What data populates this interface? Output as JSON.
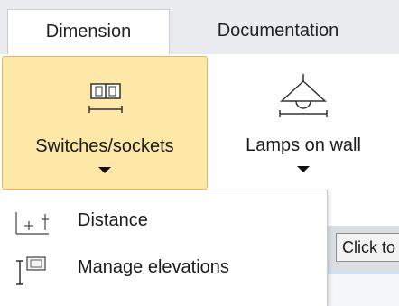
{
  "tabs": [
    {
      "label": "Dimension",
      "active": true
    },
    {
      "label": "Documentation",
      "active": false
    }
  ],
  "ribbon": {
    "switches_sockets": {
      "label": "Switches/sockets",
      "icon": "switch-socket-icon",
      "active": true
    },
    "lamps_on_wall": {
      "label": "Lamps on wall",
      "icon": "wall-lamp-icon"
    }
  },
  "dropdown": {
    "items": [
      {
        "label": "Distance",
        "icon": "distance-icon"
      },
      {
        "label": "Manage elevations",
        "icon": "elevation-icon"
      }
    ]
  },
  "statusbar": {
    "click_text": "Click to"
  },
  "colors": {
    "active_button_bg": "#fde8a8",
    "active_button_border": "#e2b95a",
    "tab_bar_bg": "#e9ebee"
  }
}
